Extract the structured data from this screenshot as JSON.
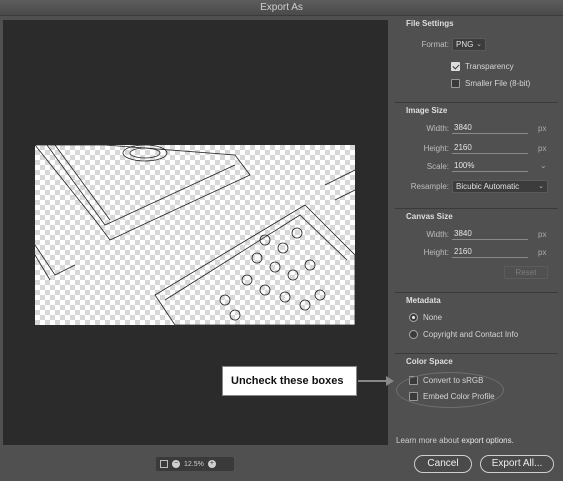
{
  "window": {
    "title": "Export As"
  },
  "file_settings": {
    "header": "File Settings",
    "format_label": "Format:",
    "format_value": "PNG",
    "transparency_label": "Transparency",
    "transparency_checked": true,
    "smaller_file_label": "Smaller File (8-bit)",
    "smaller_file_checked": false
  },
  "image_size": {
    "header": "Image Size",
    "width_label": "Width:",
    "width_value": "3840",
    "height_label": "Height:",
    "height_value": "2160",
    "scale_label": "Scale:",
    "scale_value": "100%",
    "resample_label": "Resample:",
    "resample_value": "Bicubic Automatic",
    "unit": "px"
  },
  "canvas_size": {
    "header": "Canvas Size",
    "width_label": "Width:",
    "width_value": "3840",
    "height_label": "Height:",
    "height_value": "2160",
    "unit": "px",
    "reset_label": "Reset"
  },
  "metadata": {
    "header": "Metadata",
    "options": [
      "None",
      "Copyright and Contact Info"
    ],
    "selected": "None"
  },
  "color_space": {
    "header": "Color Space",
    "convert_label": "Convert to sRGB",
    "embed_label": "Embed Color Profile"
  },
  "footer": {
    "learn_prefix": "Learn more about ",
    "learn_link": "export options.",
    "cancel_label": "Cancel",
    "export_label": "Export All..."
  },
  "zoom": {
    "value": "12.5%"
  },
  "annotation": {
    "text": "Uncheck these boxes"
  }
}
